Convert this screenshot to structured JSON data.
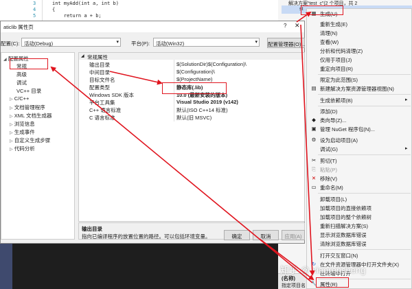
{
  "editor": {
    "lines": [
      {
        "num": "3",
        "code": "int myAdd(int a, int b)"
      },
      {
        "num": "4",
        "code": "{"
      },
      {
        "num": "5",
        "code": "    return a + b;"
      }
    ]
  },
  "solution_explorer": {
    "title": "解决方案“test_c”(2 个项目，共 2",
    "selected_project_name": "st",
    "bottom_name": "(名称)",
    "bottom_desc": "指定项目名"
  },
  "dialog": {
    "title": "aticlib 属性页",
    "help": "?",
    "close": "✕",
    "config_label": "配置(C):",
    "config_value": "活动(Debug)",
    "platform_label": "平台(P):",
    "platform_value": "活动(Win32)",
    "config_manager_button": "配置管理器(O)...",
    "tree": [
      {
        "toggle": "◢",
        "label": "配置属性"
      },
      {
        "toggle": "",
        "label": "常规"
      },
      {
        "toggle": "",
        "label": "高级"
      },
      {
        "toggle": "",
        "label": "调试"
      },
      {
        "toggle": "",
        "label": "VC++ 目录"
      },
      {
        "toggle": "▷",
        "label": "C/C++"
      },
      {
        "toggle": "▷",
        "label": "文档管理程序"
      },
      {
        "toggle": "▷",
        "label": "XML 文档生成器"
      },
      {
        "toggle": "▷",
        "label": "浏览信息"
      },
      {
        "toggle": "▷",
        "label": "生成事件"
      },
      {
        "toggle": "▷",
        "label": "自定义生成步骤"
      },
      {
        "toggle": "▷",
        "label": "代码分析"
      }
    ],
    "grid_header": "常规属性",
    "grid_rows": [
      {
        "key": "输出目录",
        "value": "$(SolutionDir)$(Configuration)\\"
      },
      {
        "key": "中间目录",
        "value": "$(Configuration)\\"
      },
      {
        "key": "目标文件名",
        "value": "$(ProjectName)"
      },
      {
        "key": "配置类型",
        "value": "静态库(.lib)"
      },
      {
        "key": "Windows SDK 版本",
        "value": "10.0 (最新安装的版本)"
      },
      {
        "key": "平台工具集",
        "value": "Visual Studio 2019 (v142)"
      },
      {
        "key": "C++ 语言标准",
        "value": "默认(ISO C++14 标准)"
      },
      {
        "key": "C 语言标准",
        "value": "默认(旧 MSVC)"
      }
    ],
    "desc_title": "输出目录",
    "desc_text": "指向已编译程序的放置位置的路径。可以包括环境变量。",
    "ok_button": "确定",
    "cancel_button": "取消",
    "apply_button": "应用(A)"
  },
  "context_menu": {
    "items": [
      {
        "icon": "build-icon",
        "glyph": "▦",
        "label": "生成(U)"
      },
      {
        "icon": "",
        "glyph": "",
        "label": "重新生成(E)"
      },
      {
        "icon": "",
        "glyph": "",
        "label": "清理(N)"
      },
      {
        "icon": "",
        "glyph": "",
        "label": "查看(W)"
      },
      {
        "icon": "",
        "glyph": "",
        "label": "分析和代码清理(Z)"
      },
      {
        "icon": "",
        "glyph": "",
        "label": "仅用于项目(J)"
      },
      {
        "icon": "",
        "glyph": "",
        "label": "重定向项目(R)"
      },
      {
        "icon": "",
        "glyph": "",
        "label": "限定为此范围(S)"
      },
      {
        "icon": "new-view-icon",
        "glyph": "▤",
        "label": "新建解决方案资源管理器视图(N)"
      },
      {
        "icon": "",
        "glyph": "",
        "label": "生成依赖项(B)"
      },
      {
        "icon": "",
        "glyph": "",
        "label": "添加(D)"
      },
      {
        "icon": "class-wizard-icon",
        "glyph": "◆",
        "label": "类向导(Z)..."
      },
      {
        "icon": "nuget-icon",
        "glyph": "▣",
        "label": "管理 NuGet 程序包(N)..."
      },
      {
        "icon": "gear-icon",
        "glyph": "⚙",
        "label": "设为启动项目(A)"
      },
      {
        "icon": "",
        "glyph": "",
        "label": "调试(G)"
      },
      {
        "icon": "cut-icon",
        "glyph": "✂",
        "label": "剪切(T)"
      },
      {
        "icon": "paste-icon",
        "glyph": "⎘",
        "label": "粘贴(P)"
      },
      {
        "icon": "remove-icon",
        "glyph": "✕",
        "label": "移除(V)"
      },
      {
        "icon": "rename-icon",
        "glyph": "▭",
        "label": "重命名(M)"
      },
      {
        "icon": "",
        "glyph": "",
        "label": "卸载项目(L)"
      },
      {
        "icon": "",
        "glyph": "",
        "label": "加载项目的直接依赖项"
      },
      {
        "icon": "",
        "glyph": "",
        "label": "加载项目的整个依赖树"
      },
      {
        "icon": "",
        "glyph": "",
        "label": "重新扫描解决方案(S)"
      },
      {
        "icon": "",
        "glyph": "",
        "label": "显示浏览数据库错误"
      },
      {
        "icon": "",
        "glyph": "",
        "label": "清除浏览数据库错误"
      },
      {
        "icon": "",
        "glyph": "",
        "label": "打开交互窗口(N)"
      },
      {
        "icon": "open-folder-icon",
        "glyph": "↻",
        "label": "在文件资源管理器中打开文件夹(X)"
      },
      {
        "icon": "",
        "glyph": "",
        "label": "在终端中打开"
      },
      {
        "icon": "wrench-icon",
        "glyph": "🔧",
        "label": "属性(R)"
      }
    ],
    "submenu_arrows": [
      "▸",
      "▸"
    ]
  },
  "watermark": "知乎 @ xiaorensheng",
  "colors": {
    "highlight": "#e0141e",
    "selection": "#c8daf5",
    "link": "#2b91af"
  }
}
